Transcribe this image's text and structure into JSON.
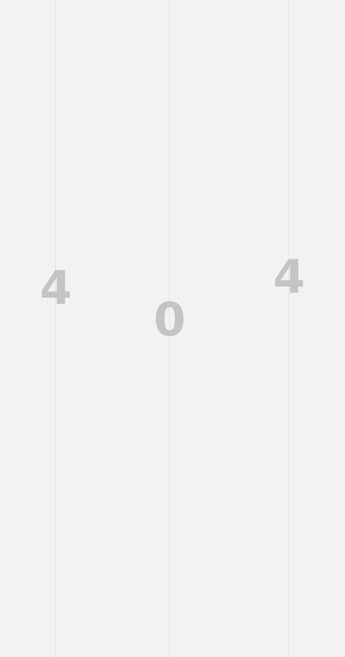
{
  "error_display": {
    "digits": [
      "4",
      "0",
      "4"
    ]
  },
  "colors": {
    "background": "#f2f2f2",
    "line": "#e2e2e2",
    "digit": "#c4c4c4"
  }
}
